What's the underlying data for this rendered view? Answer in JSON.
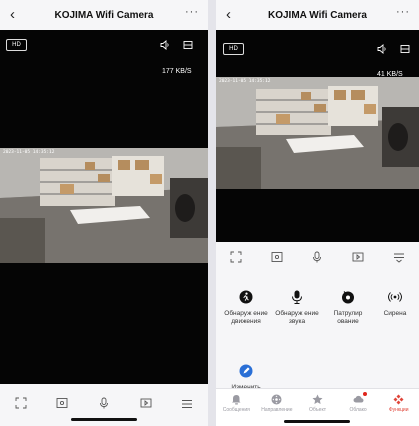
{
  "left": {
    "title": "KOJIMA Wifi Camera",
    "back_icon": "chevron-left-icon",
    "more": "···",
    "hd_label": "HD",
    "speed": "177 KB/S",
    "timestamp": "2023-11-05 14:35:12",
    "controls": [
      "fullscreen-icon",
      "screenshot-icon",
      "microphone-icon",
      "record-icon",
      "menu-icon"
    ]
  },
  "right": {
    "title": "KOJIMA Wifi Camera",
    "back_icon": "chevron-left-icon",
    "more": "···",
    "hd_label": "HD",
    "speed": "41 KB/S",
    "timestamp": "2023-11-05 14:35:12",
    "controls": [
      "fullscreen-icon",
      "screenshot-icon",
      "microphone-icon",
      "record-icon",
      "collapse-icon"
    ],
    "features": [
      {
        "label": "Обнаруж ение движения",
        "icon": "motion-detection-icon"
      },
      {
        "label": "Обнаруж ение звука",
        "icon": "sound-detection-icon"
      },
      {
        "label": "Патрулир ование",
        "icon": "patrol-icon"
      },
      {
        "label": "Сирена",
        "icon": "siren-icon"
      },
      {
        "label": "Изменить",
        "icon": "edit-icon"
      }
    ],
    "tabs": [
      {
        "label": "Сообщения",
        "icon": "bell-icon",
        "active": false
      },
      {
        "label": "Направление",
        "icon": "direction-icon",
        "active": false
      },
      {
        "label": "Объект",
        "icon": "star-icon",
        "active": false
      },
      {
        "label": "Облако",
        "icon": "cloud-icon",
        "active": false
      },
      {
        "label": "Функции",
        "icon": "functions-icon",
        "active": true
      }
    ],
    "accent_color": "#e0463a",
    "badge_color": "#e0261c"
  }
}
